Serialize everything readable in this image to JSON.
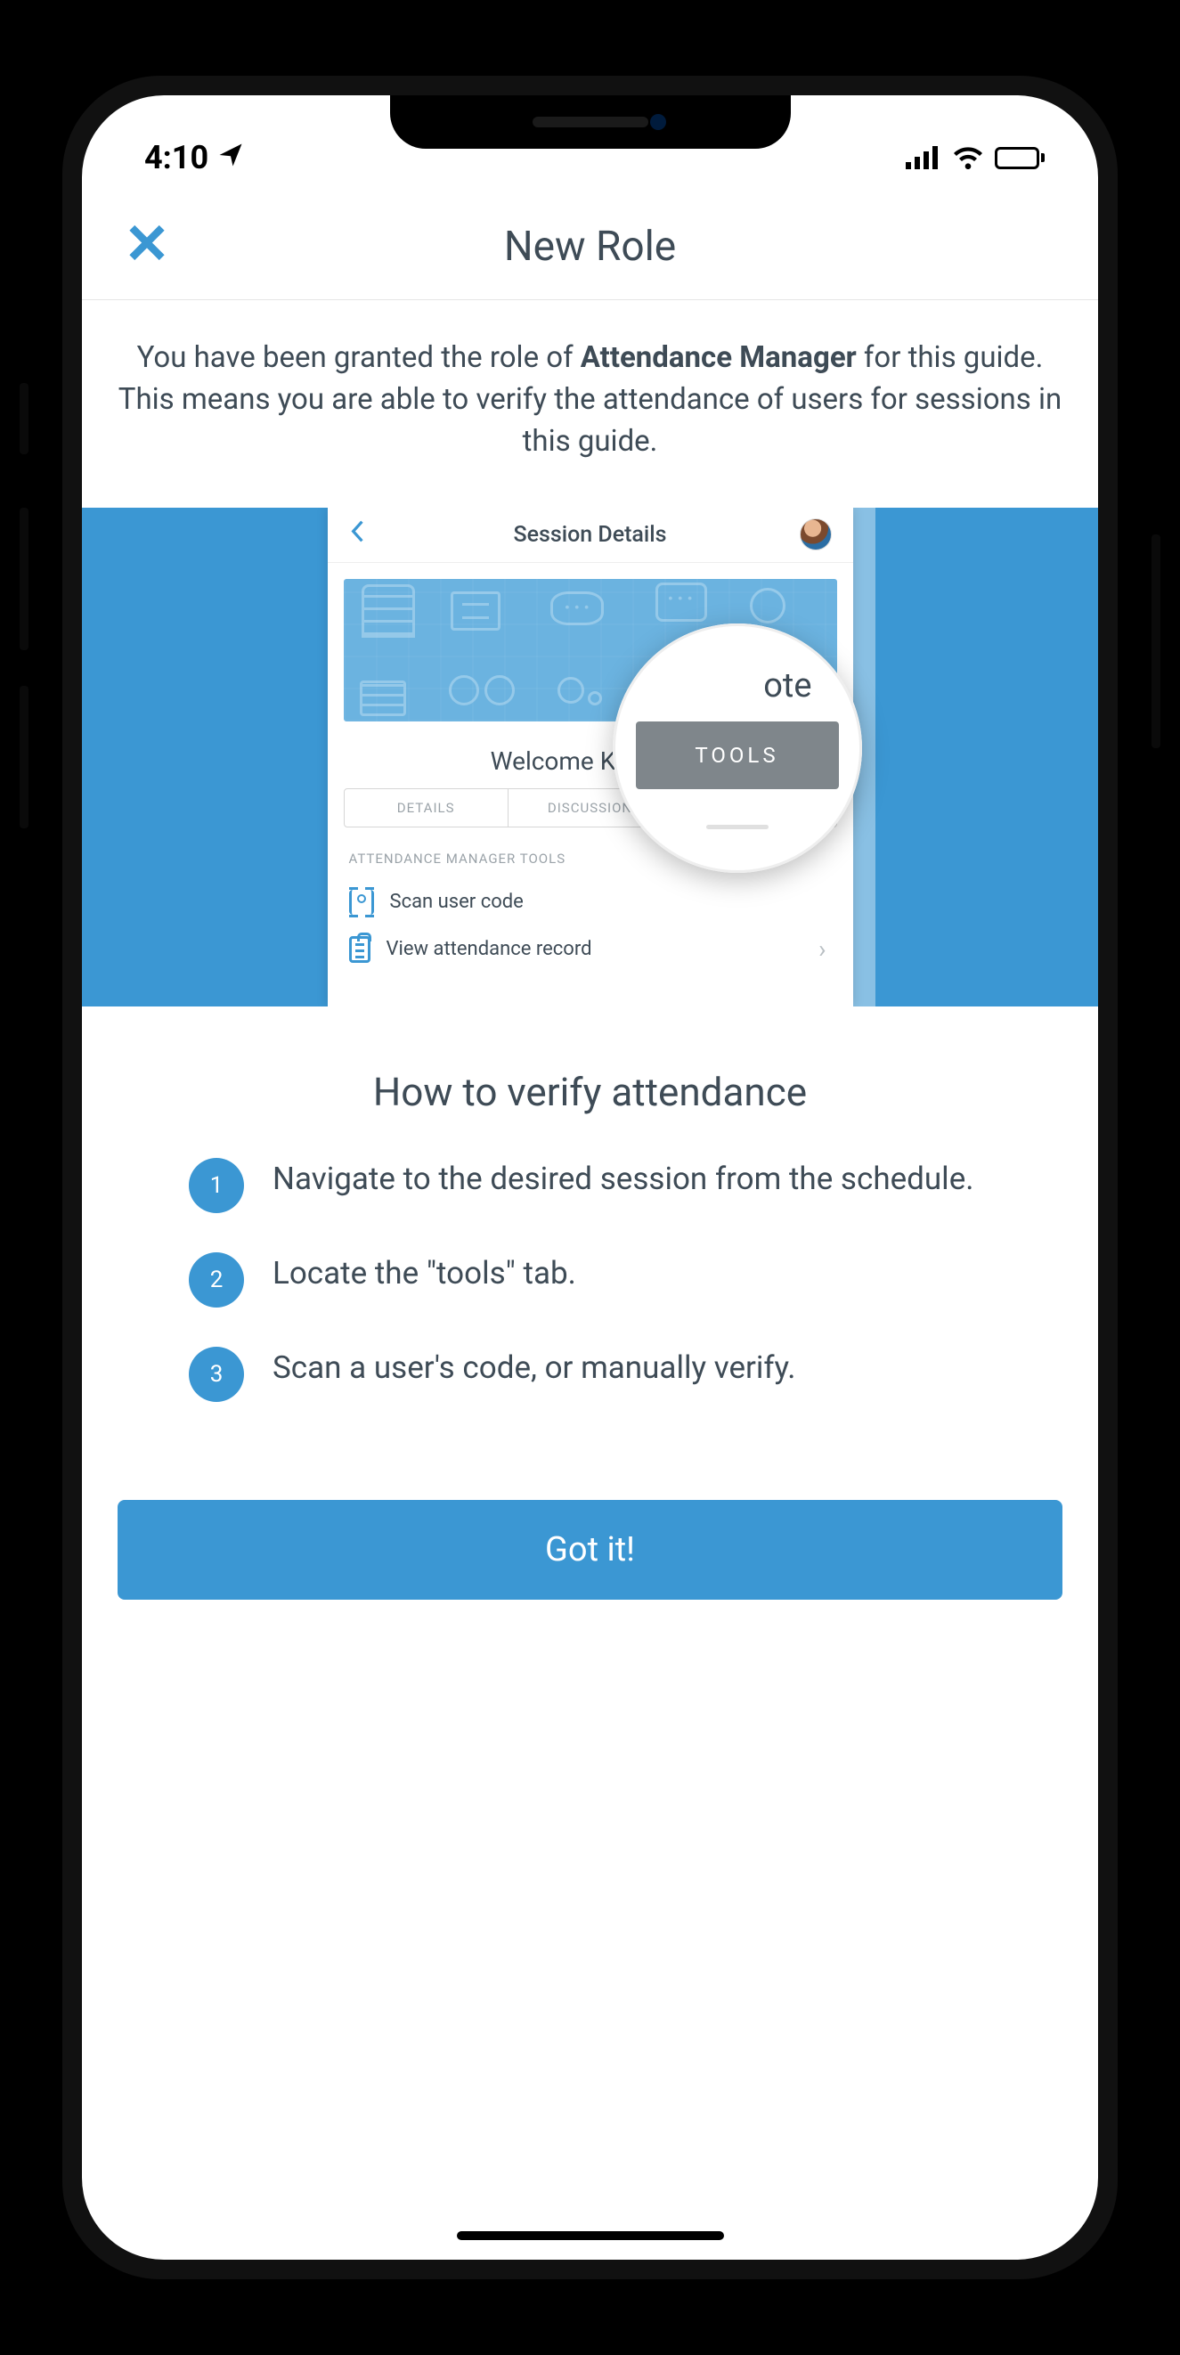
{
  "status_bar": {
    "time": "4:10"
  },
  "header": {
    "title": "New Role"
  },
  "intro": {
    "prefix": "You have been granted the role of ",
    "role_name": "Attendance Manager",
    "suffix": " for this guide. This means you are able to verify the attendance of users for sessions in this guide."
  },
  "illustration": {
    "mini_header_title": "Session Details",
    "session_title": "Welcome Keynote",
    "tabs": [
      "DETAILS",
      "DISCUSSION",
      "TOOLS"
    ],
    "section_label": "ATTENDANCE MANAGER TOOLS",
    "row_scan": "Scan user code",
    "row_record": "View attendance record",
    "magnifier_partial": "ote",
    "magnifier_tools": "TOOLS"
  },
  "howto": {
    "title": "How to verify attendance",
    "steps": [
      {
        "n": "1",
        "text": "Navigate to the desired session from the schedule."
      },
      {
        "n": "2",
        "text": "Locate the \"tools\" tab."
      },
      {
        "n": "3",
        "text": "Scan a user's code, or manually verify."
      }
    ]
  },
  "cta": {
    "label": "Got it!"
  }
}
